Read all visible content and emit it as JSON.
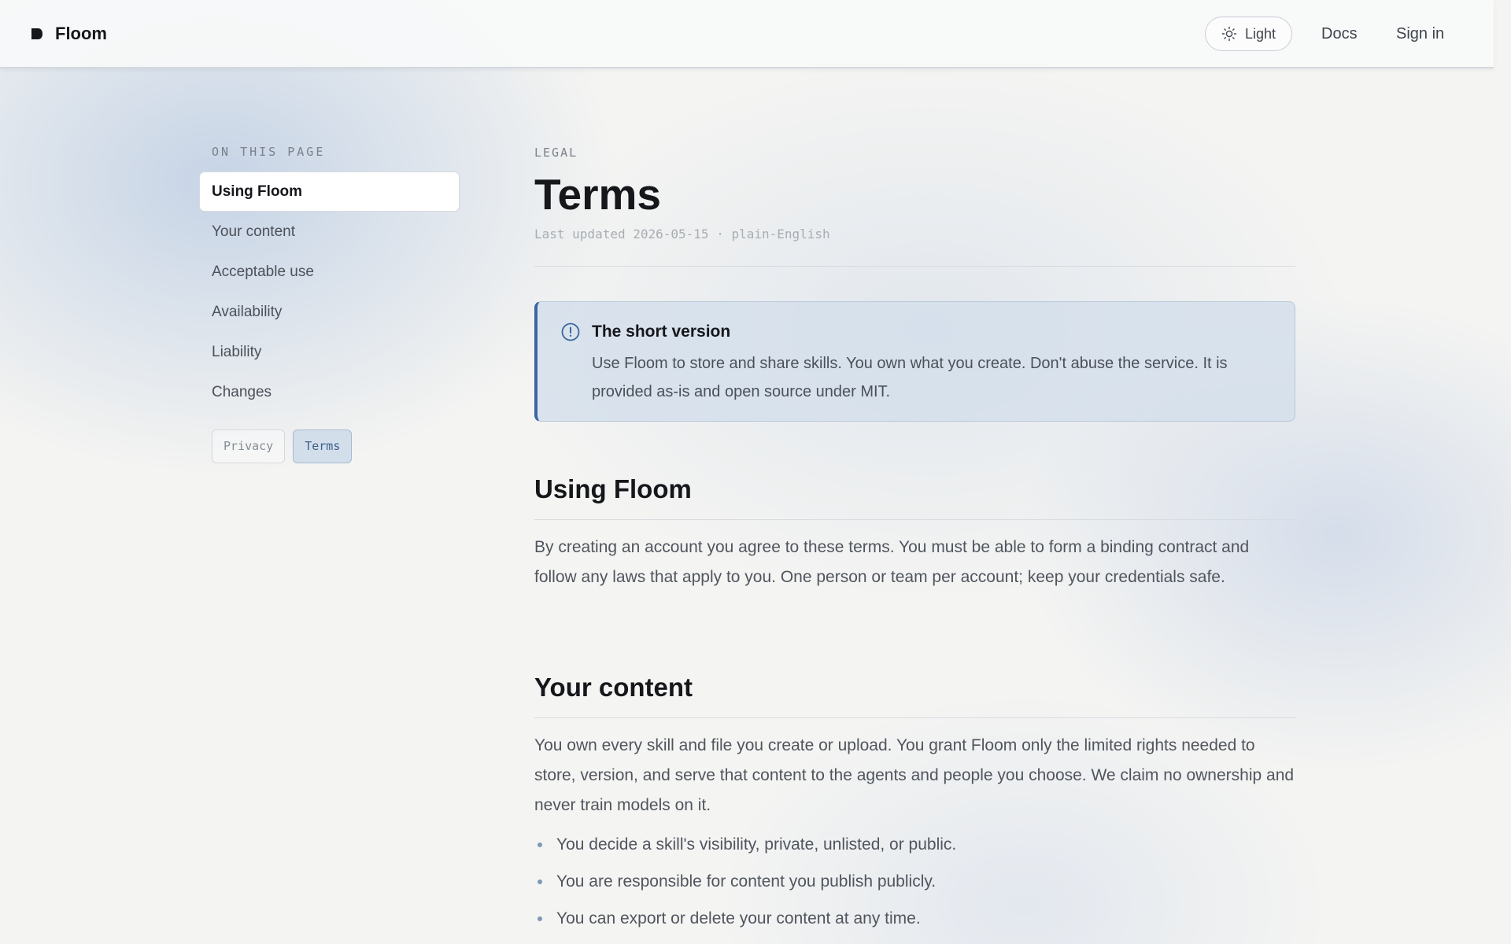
{
  "header": {
    "brand_name": "Floom",
    "brand_icon": "floom-logo-icon",
    "theme_label": "Light",
    "theme_icon": "sun-icon",
    "nav": {
      "docs": "Docs",
      "sign_in": "Sign in"
    }
  },
  "sidebar": {
    "heading": "ON THIS PAGE",
    "items": [
      {
        "label": "Using Floom",
        "active": true
      },
      {
        "label": "Your content",
        "active": false
      },
      {
        "label": "Acceptable use",
        "active": false
      },
      {
        "label": "Availability",
        "active": false
      },
      {
        "label": "Liability",
        "active": false
      },
      {
        "label": "Changes",
        "active": false
      }
    ],
    "chips": [
      {
        "label": "Privacy",
        "active": false
      },
      {
        "label": "Terms",
        "active": true
      }
    ]
  },
  "main": {
    "eyebrow": "LEGAL",
    "title": "Terms",
    "updated": "Last updated 2026-05-15 · plain-English",
    "callout": {
      "icon": "info-icon",
      "title": "The short version",
      "body": "Use Floom to store and share skills. You own what you create. Don't abuse the service. It is provided as-is and open source under MIT."
    },
    "sections": [
      {
        "title": "Using Floom",
        "body": "By creating an account you agree to these terms. You must be able to form a binding contract and follow any laws that apply to you. One person or team per account; keep your credentials safe."
      },
      {
        "title": "Your content",
        "body": "You own every skill and file you create or upload. You grant Floom only the limited rights needed to store, version, and serve that content to the agents and people you choose. We claim no ownership and never train models on it.",
        "bullets": [
          "You decide a skill's visibility, private, unlisted, or public.",
          "You are responsible for content you publish publicly.",
          "You can export or delete your content at any time."
        ]
      }
    ]
  },
  "colors": {
    "accent": "#3a65a0",
    "callout_bg": "#d3deeb",
    "page_bg": "#f4f4f2"
  }
}
